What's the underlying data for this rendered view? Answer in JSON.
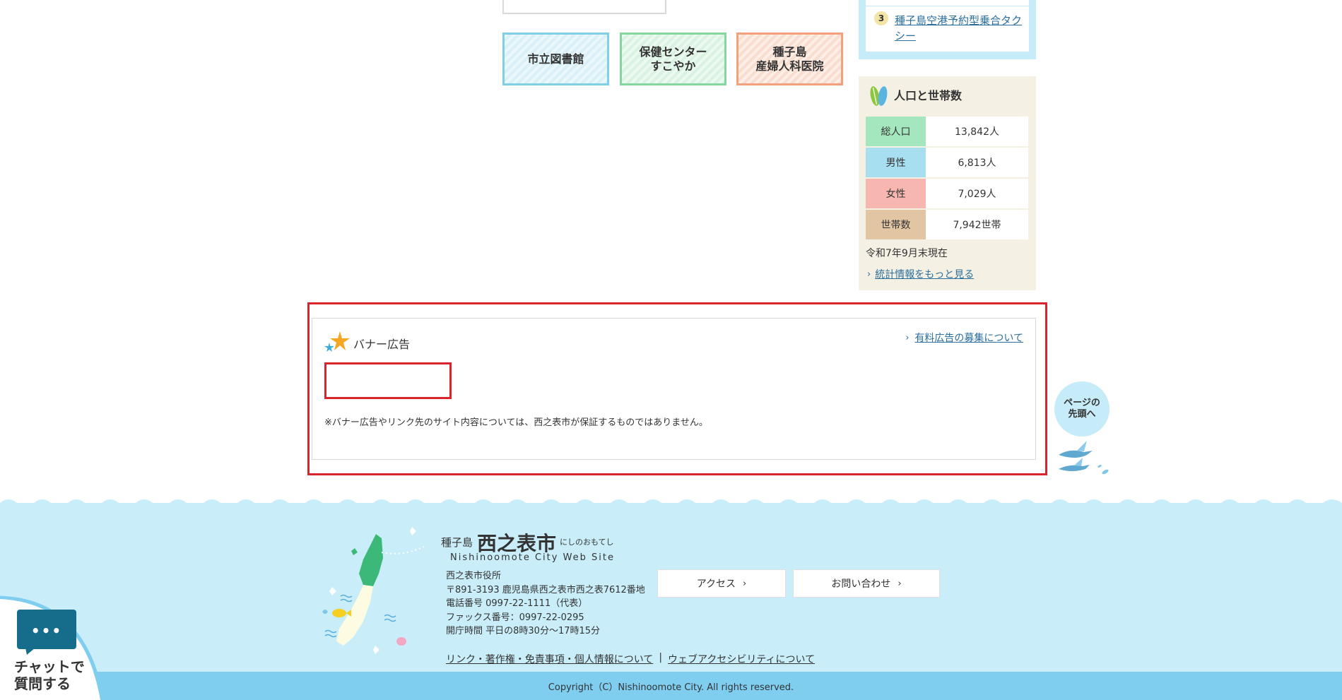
{
  "quick_links": [
    {
      "label": "市立図書館"
    },
    {
      "label": "保健センター\nすこやか"
    },
    {
      "label": "種子島\n産婦人科医院"
    }
  ],
  "ranking": {
    "item_number": "3",
    "item_label": "種子島空港予約型乗合タクシー"
  },
  "population": {
    "title": "人口と世帯数",
    "rows": [
      {
        "label": "総人口",
        "value": "13,842人",
        "color": "#a4e6bd"
      },
      {
        "label": "男性",
        "value": "6,813人",
        "color": "#a8dff0"
      },
      {
        "label": "女性",
        "value": "7,029人",
        "color": "#f7b7b0"
      },
      {
        "label": "世帯数",
        "value": "7,942世帯",
        "color": "#e2c6a4"
      }
    ],
    "as_of": "令和7年9月末現在",
    "more_link": "統計情報をもっと見る"
  },
  "banner": {
    "title": "バナー広告",
    "paid_link": "有料広告の募集について",
    "note": "※バナー広告やリンク先のサイト内容については、西之表市が保証するものではありません。"
  },
  "page_top": {
    "label": "ページの\n先頭へ"
  },
  "footer": {
    "site_prefix": "種子島",
    "site_name": "西之表市",
    "site_kana": "にしのおもてし",
    "site_en": "Nishinoomote City Web Site",
    "office_lines": [
      "西之表市役所",
      "〒891-3193 鹿児島県西之表市西之表7612番地",
      "電話番号 0997-22-1111（代表）",
      "ファックス番号：0997-22-0295",
      "開庁時間 平日の8時30分～17時15分"
    ],
    "access_button": "アクセス",
    "contact_button": "お問い合わせ",
    "link_legal": "リンク・著作権・免責事項・個人情報について",
    "link_separator": "|",
    "link_accessibility": "ウェブアクセシビリティについて",
    "copyright": "Copyright（C）Nishinoomote City. All rights reserved."
  },
  "chat": {
    "label": "チャットで\n質問する",
    "dots": "•••"
  },
  "colors": {
    "accent_red": "#d9242c",
    "link_blue": "#2a6e9c",
    "footer_light": "#c9eefa",
    "footer_bar": "#7fcef0"
  }
}
